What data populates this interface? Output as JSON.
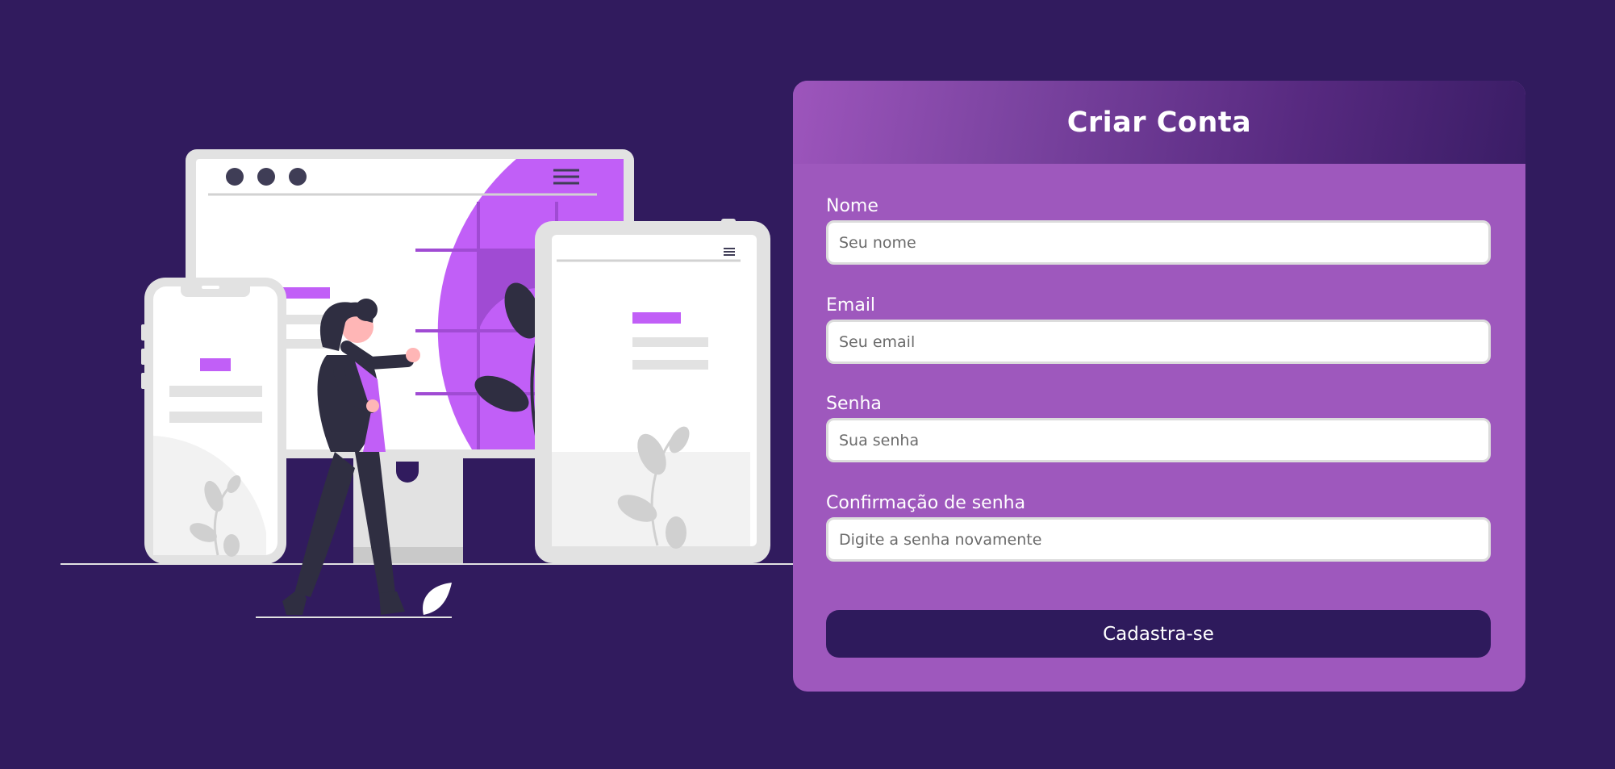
{
  "colors": {
    "background": "#311b5e",
    "card": "#9e58bd",
    "button": "#2e1a5c",
    "accent": "#c15ff7"
  },
  "form": {
    "title": "Criar Conta",
    "fields": [
      {
        "label": "Nome",
        "placeholder": "Seu nome",
        "value": ""
      },
      {
        "label": "Email",
        "placeholder": "Seu email",
        "value": ""
      },
      {
        "label": "Senha",
        "placeholder": "Sua senha",
        "value": ""
      },
      {
        "label": "Confirmação de senha",
        "placeholder": "Digite a senha novamente",
        "value": ""
      }
    ],
    "submit_label": "Cadastra-se"
  },
  "illustration": {
    "icons": [
      "window-dots-icon",
      "hamburger-menu-icon",
      "plant-icon",
      "leaf-icon"
    ]
  }
}
